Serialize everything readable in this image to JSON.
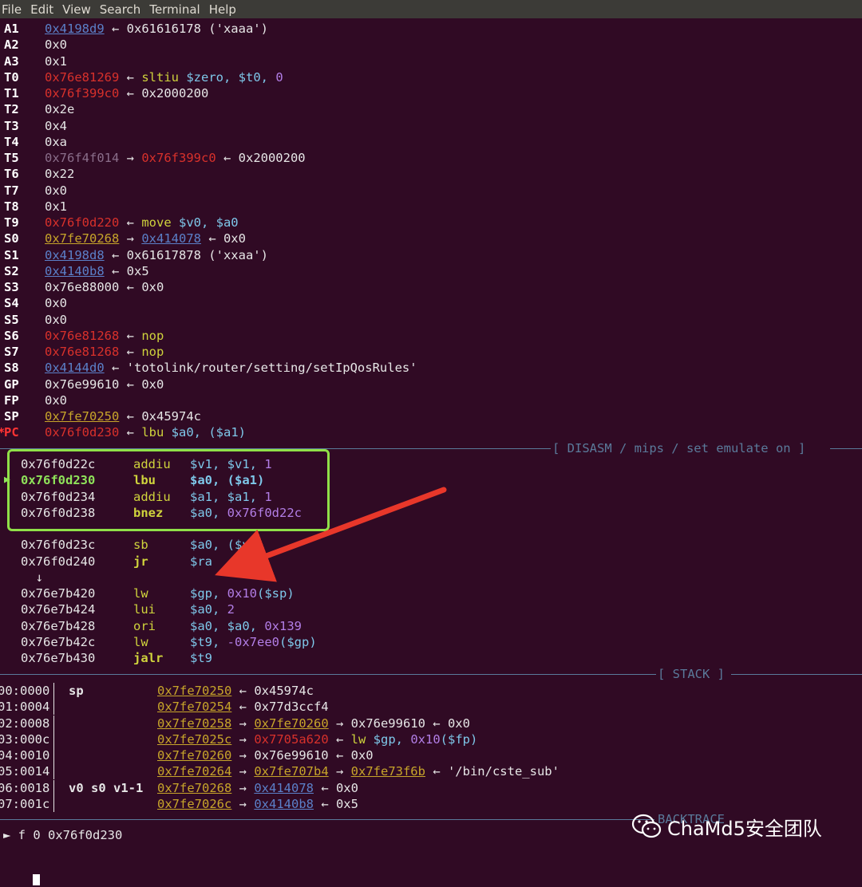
{
  "menubar": [
    "File",
    "Edit",
    "View",
    "Search",
    "Terminal",
    "Help"
  ],
  "registers": [
    {
      "name": "A1",
      "parts": [
        {
          "t": "0x4198d9",
          "c": "c-heap u"
        },
        {
          "t": " ← 0x61616178 ('xaaa')",
          "c": "c-str"
        }
      ]
    },
    {
      "name": "A2",
      "parts": [
        {
          "t": "0x0",
          "c": "c-str"
        }
      ]
    },
    {
      "name": "A3",
      "parts": [
        {
          "t": "0x1",
          "c": "c-str"
        }
      ]
    },
    {
      "name": "T0",
      "parts": [
        {
          "t": "0x76e81269",
          "c": "c-code"
        },
        {
          "t": " ← ",
          "c": "c-str"
        },
        {
          "t": "sltiu",
          "c": "c-mn"
        },
        {
          "t": " $zero, $t0, ",
          "c": "c-op"
        },
        {
          "t": "0",
          "c": "c-num"
        }
      ]
    },
    {
      "name": "T1",
      "parts": [
        {
          "t": "0x76f399c0",
          "c": "c-code"
        },
        {
          "t": " ← 0x2000200",
          "c": "c-str"
        }
      ]
    },
    {
      "name": "T2",
      "parts": [
        {
          "t": "0x2e",
          "c": "c-str"
        }
      ]
    },
    {
      "name": "T3",
      "parts": [
        {
          "t": "0x4",
          "c": "c-str"
        }
      ]
    },
    {
      "name": "T4",
      "parts": [
        {
          "t": "0xa",
          "c": "c-str"
        }
      ]
    },
    {
      "name": "T5",
      "parts": [
        {
          "t": "0x76f4f014",
          "c": "c-data"
        },
        {
          "t": " → ",
          "c": "c-str"
        },
        {
          "t": "0x76f399c0",
          "c": "c-code"
        },
        {
          "t": " ← 0x2000200",
          "c": "c-str"
        }
      ]
    },
    {
      "name": "T6",
      "parts": [
        {
          "t": "0x22",
          "c": "c-str"
        }
      ]
    },
    {
      "name": "T7",
      "parts": [
        {
          "t": "0x0",
          "c": "c-str"
        }
      ]
    },
    {
      "name": "T8",
      "parts": [
        {
          "t": "0x1",
          "c": "c-str"
        }
      ]
    },
    {
      "name": "T9",
      "parts": [
        {
          "t": "0x76f0d220",
          "c": "c-code"
        },
        {
          "t": " ← ",
          "c": "c-str"
        },
        {
          "t": "move",
          "c": "c-mn"
        },
        {
          "t": " $v0, $a0",
          "c": "c-op"
        }
      ]
    },
    {
      "name": "S0",
      "parts": [
        {
          "t": "0x7fe70268",
          "c": "c-stack u"
        },
        {
          "t": " → ",
          "c": "c-str"
        },
        {
          "t": "0x414078",
          "c": "c-heap u"
        },
        {
          "t": " ← 0x0",
          "c": "c-str"
        }
      ]
    },
    {
      "name": "S1",
      "parts": [
        {
          "t": "0x4198d8",
          "c": "c-heap u"
        },
        {
          "t": " ← 0x61617878 ('xxaa')",
          "c": "c-str"
        }
      ]
    },
    {
      "name": "S2",
      "parts": [
        {
          "t": "0x4140b8",
          "c": "c-heap u"
        },
        {
          "t": " ← 0x5",
          "c": "c-str"
        }
      ]
    },
    {
      "name": "S3",
      "parts": [
        {
          "t": "0x76e88000 ← 0x0",
          "c": "c-str"
        }
      ]
    },
    {
      "name": "S4",
      "parts": [
        {
          "t": "0x0",
          "c": "c-str"
        }
      ]
    },
    {
      "name": "S5",
      "parts": [
        {
          "t": "0x0",
          "c": "c-str"
        }
      ]
    },
    {
      "name": "S6",
      "parts": [
        {
          "t": "0x76e81268",
          "c": "c-code"
        },
        {
          "t": " ← ",
          "c": "c-str"
        },
        {
          "t": "nop",
          "c": "c-mn"
        }
      ]
    },
    {
      "name": "S7",
      "parts": [
        {
          "t": "0x76e81268",
          "c": "c-code"
        },
        {
          "t": " ← ",
          "c": "c-str"
        },
        {
          "t": "nop",
          "c": "c-mn"
        }
      ]
    },
    {
      "name": "S8",
      "parts": [
        {
          "t": "0x4144d0",
          "c": "c-heap u"
        },
        {
          "t": " ← 'totolink/router/setting/setIpQosRules'",
          "c": "c-str"
        }
      ]
    },
    {
      "name": "GP",
      "parts": [
        {
          "t": "0x76e99610 ← 0x0",
          "c": "c-str"
        }
      ]
    },
    {
      "name": "FP",
      "parts": [
        {
          "t": "0x0",
          "c": "c-str"
        }
      ]
    },
    {
      "name": "SP",
      "parts": [
        {
          "t": "0x7fe70250",
          "c": "c-stack u"
        },
        {
          "t": " ← 0x45974c",
          "c": "c-str"
        }
      ]
    },
    {
      "name": "PC",
      "star": "*",
      "parts": [
        {
          "t": "0x76f0d230",
          "c": "c-code"
        },
        {
          "t": " ← ",
          "c": "c-str"
        },
        {
          "t": "lbu",
          "c": "c-mn"
        },
        {
          "t": " $a0, ($a1)",
          "c": "c-op"
        }
      ]
    }
  ],
  "disasm_header": "[ DISASM / mips / set emulate on ]",
  "disasm": [
    {
      "addr": "0x76f0d22c",
      "mn": "addiu",
      "mnc": "c-mn",
      "ops": [
        {
          "t": "$v1, $v1, ",
          "c": "c-op"
        },
        {
          "t": "1",
          "c": "c-num"
        }
      ]
    },
    {
      "addr": "0x76f0d230",
      "current": true,
      "mn": "lbu",
      "mnc": "c-mnb",
      "ops": [
        {
          "t": "$a0, ($a1)",
          "c": "c-op"
        }
      ]
    },
    {
      "addr": "0x76f0d234",
      "mn": "addiu",
      "mnc": "c-mn",
      "ops": [
        {
          "t": "$a1, $a1, ",
          "c": "c-op"
        },
        {
          "t": "1",
          "c": "c-num"
        }
      ]
    },
    {
      "addr": "0x76f0d238",
      "mn": "bnez",
      "mnc": "c-mnb",
      "ops": [
        {
          "t": "$a0, ",
          "c": "c-op"
        },
        {
          "t": "0x76f0d22c",
          "c": "c-num"
        }
      ]
    },
    {
      "addr": "",
      "mn": "",
      "mnc": "c-mn",
      "ops": []
    },
    {
      "addr": "0x76f0d23c",
      "mn": "sb",
      "mnc": "c-mn",
      "ops": [
        {
          "t": "$a0, ($v1)",
          "c": "c-op"
        }
      ]
    },
    {
      "addr": "0x76f0d240",
      "mn": "jr",
      "mnc": "c-mnb",
      "ops": [
        {
          "t": "$ra",
          "c": "c-op"
        }
      ]
    },
    {
      "addr": "  ↓",
      "mn": "",
      "mnc": "c-mn",
      "ops": []
    },
    {
      "addr": "0x76e7b420",
      "mn": "lw",
      "mnc": "c-mn",
      "ops": [
        {
          "t": "$gp, ",
          "c": "c-op"
        },
        {
          "t": "0x10",
          "c": "c-num"
        },
        {
          "t": "($sp)",
          "c": "c-op"
        }
      ]
    },
    {
      "addr": "0x76e7b424",
      "mn": "lui",
      "mnc": "c-mn",
      "ops": [
        {
          "t": "$a0, ",
          "c": "c-op"
        },
        {
          "t": "2",
          "c": "c-num"
        }
      ]
    },
    {
      "addr": "0x76e7b428",
      "mn": "ori",
      "mnc": "c-mn",
      "ops": [
        {
          "t": "$a0, $a0, ",
          "c": "c-op"
        },
        {
          "t": "0x139",
          "c": "c-num"
        }
      ]
    },
    {
      "addr": "0x76e7b42c",
      "mn": "lw",
      "mnc": "c-mn",
      "ops": [
        {
          "t": "$t9, ",
          "c": "c-op"
        },
        {
          "t": "-0x7ee0",
          "c": "c-num"
        },
        {
          "t": "($gp)",
          "c": "c-op"
        }
      ]
    },
    {
      "addr": "0x76e7b430",
      "mn": "jalr",
      "mnc": "c-mnb",
      "ops": [
        {
          "t": "$t9",
          "c": "c-op"
        }
      ]
    }
  ],
  "stack_header": "[ STACK ]",
  "stack": [
    {
      "off": "00:0000",
      "label": "sp",
      "parts": [
        {
          "t": "0x7fe70250",
          "c": "c-stack u"
        },
        {
          "t": " ← 0x45974c",
          "c": "c-str"
        }
      ]
    },
    {
      "off": "01:0004",
      "label": "",
      "parts": [
        {
          "t": "0x7fe70254",
          "c": "c-stack u"
        },
        {
          "t": " ← 0x77d3ccf4",
          "c": "c-str"
        }
      ]
    },
    {
      "off": "02:0008",
      "label": "",
      "parts": [
        {
          "t": "0x7fe70258",
          "c": "c-stack u"
        },
        {
          "t": " → ",
          "c": "c-str"
        },
        {
          "t": "0x7fe70260",
          "c": "c-stack u"
        },
        {
          "t": " → 0x76e99610 ← 0x0",
          "c": "c-str"
        }
      ]
    },
    {
      "off": "03:000c",
      "label": "",
      "parts": [
        {
          "t": "0x7fe7025c",
          "c": "c-stack u"
        },
        {
          "t": " → ",
          "c": "c-str"
        },
        {
          "t": "0x7705a620",
          "c": "c-code"
        },
        {
          "t": " ← ",
          "c": "c-str"
        },
        {
          "t": "lw",
          "c": "c-mn"
        },
        {
          "t": " $gp, ",
          "c": "c-op"
        },
        {
          "t": "0x10",
          "c": "c-num"
        },
        {
          "t": "($fp)",
          "c": "c-op"
        }
      ]
    },
    {
      "off": "04:0010",
      "label": "",
      "parts": [
        {
          "t": "0x7fe70260",
          "c": "c-stack u"
        },
        {
          "t": " → 0x76e99610 ← 0x0",
          "c": "c-str"
        }
      ]
    },
    {
      "off": "05:0014",
      "label": "",
      "parts": [
        {
          "t": "0x7fe70264",
          "c": "c-stack u"
        },
        {
          "t": " → ",
          "c": "c-str"
        },
        {
          "t": "0x7fe707b4",
          "c": "c-stack u"
        },
        {
          "t": " → ",
          "c": "c-str"
        },
        {
          "t": "0x7fe73f6b",
          "c": "c-stack u"
        },
        {
          "t": " ← '/bin/cste_sub'",
          "c": "c-str"
        }
      ]
    },
    {
      "off": "06:0018",
      "label": "v0 s0 v1-1",
      "parts": [
        {
          "t": "0x7fe70268",
          "c": "c-stack u"
        },
        {
          "t": " → ",
          "c": "c-str"
        },
        {
          "t": "0x414078",
          "c": "c-heap u"
        },
        {
          "t": " ← 0x0",
          "c": "c-str"
        }
      ]
    },
    {
      "off": "07:001c",
      "label": "",
      "parts": [
        {
          "t": "0x7fe7026c",
          "c": "c-stack u"
        },
        {
          "t": " → ",
          "c": "c-str"
        },
        {
          "t": "0x4140b8",
          "c": "c-heap u"
        },
        {
          "t": " ← 0x5",
          "c": "c-str"
        }
      ]
    }
  ],
  "backtrace_header": "BACKTRACE",
  "backtrace": "► f 0 0x76f0d230",
  "watermark": "ChaMd5安全团队",
  "colors": {
    "bg": "#300a24",
    "highlight": "#90e048",
    "annotation_arrow": "#e8372a"
  }
}
